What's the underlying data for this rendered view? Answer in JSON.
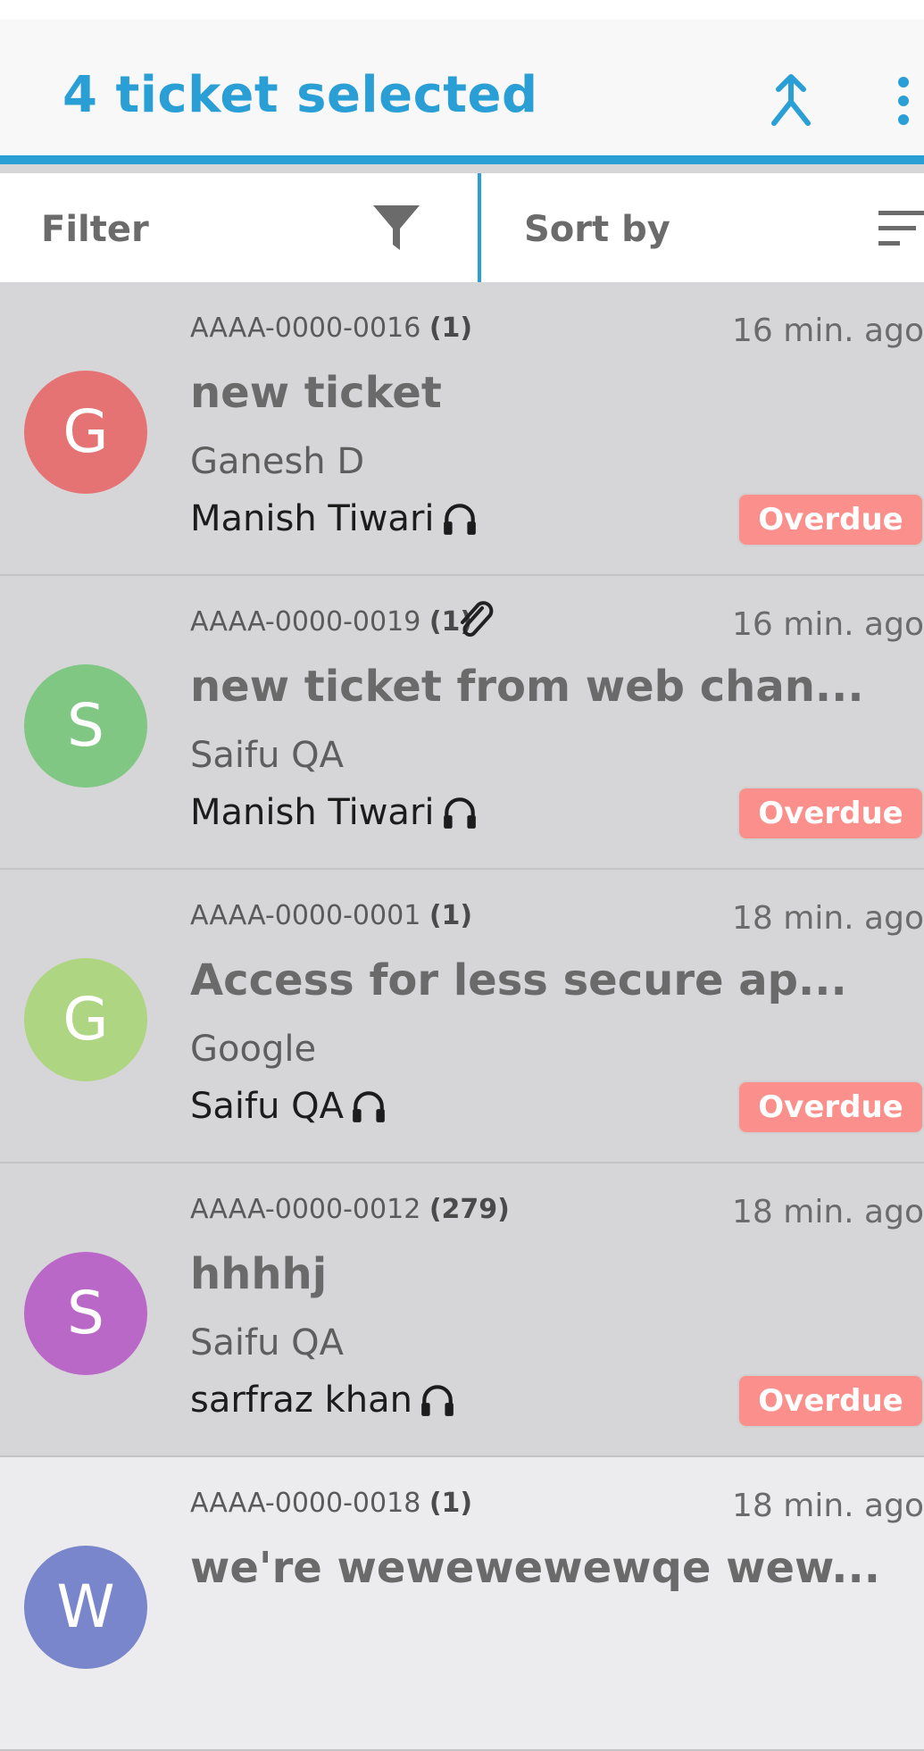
{
  "header": {
    "title": "4 ticket selected",
    "actions": {
      "merge_icon": "merge-icon",
      "more_icon": "more-vert-icon"
    }
  },
  "controls": {
    "filter_label": "Filter",
    "filter_icon": "filter-funnel-icon",
    "sort_label": "Sort by",
    "sort_icon": "sort-lines-icon"
  },
  "colors": {
    "accent": "#2a9fd6",
    "overdue": "#fb8f8b",
    "selected_row": "#d6d6d8",
    "unselected_row": "#ececee"
  },
  "tickets": [
    {
      "avatar_letter": "G",
      "avatar_color": "#e57373",
      "id": "AAAA-0000-0016",
      "count": "(1)",
      "attachment": false,
      "time": "16 min. ago",
      "subject": "new ticket",
      "requester": "Ganesh D",
      "agent": "Manish Tiwari",
      "badge": "Overdue",
      "selected": true
    },
    {
      "avatar_letter": "S",
      "avatar_color": "#81c784",
      "id": "AAAA-0000-0019",
      "count": "(1)",
      "attachment": true,
      "time": "16 min. ago",
      "subject": "new ticket from web chan...",
      "requester": "Saifu QA",
      "agent": "Manish Tiwari",
      "badge": "Overdue",
      "selected": true
    },
    {
      "avatar_letter": "G",
      "avatar_color": "#aed581",
      "id": "AAAA-0000-0001",
      "count": "(1)",
      "attachment": false,
      "time": "18 min. ago",
      "subject": "Access for less secure ap...",
      "requester": "Google",
      "agent": "Saifu QA",
      "badge": "Overdue",
      "selected": true
    },
    {
      "avatar_letter": "S",
      "avatar_color": "#ba68c8",
      "id": "AAAA-0000-0012",
      "count": "(279)",
      "attachment": false,
      "time": "18 min. ago",
      "subject": "hhhhj",
      "requester": "Saifu QA",
      "agent": "sarfraz khan",
      "badge": "Overdue",
      "selected": true
    },
    {
      "avatar_letter": "W",
      "avatar_color": "#7986cb",
      "id": "AAAA-0000-0018",
      "count": "(1)",
      "attachment": false,
      "time": "18 min. ago",
      "subject": "we're wewewewewqe wew...",
      "requester": "",
      "agent": "",
      "badge": "",
      "selected": false
    }
  ]
}
